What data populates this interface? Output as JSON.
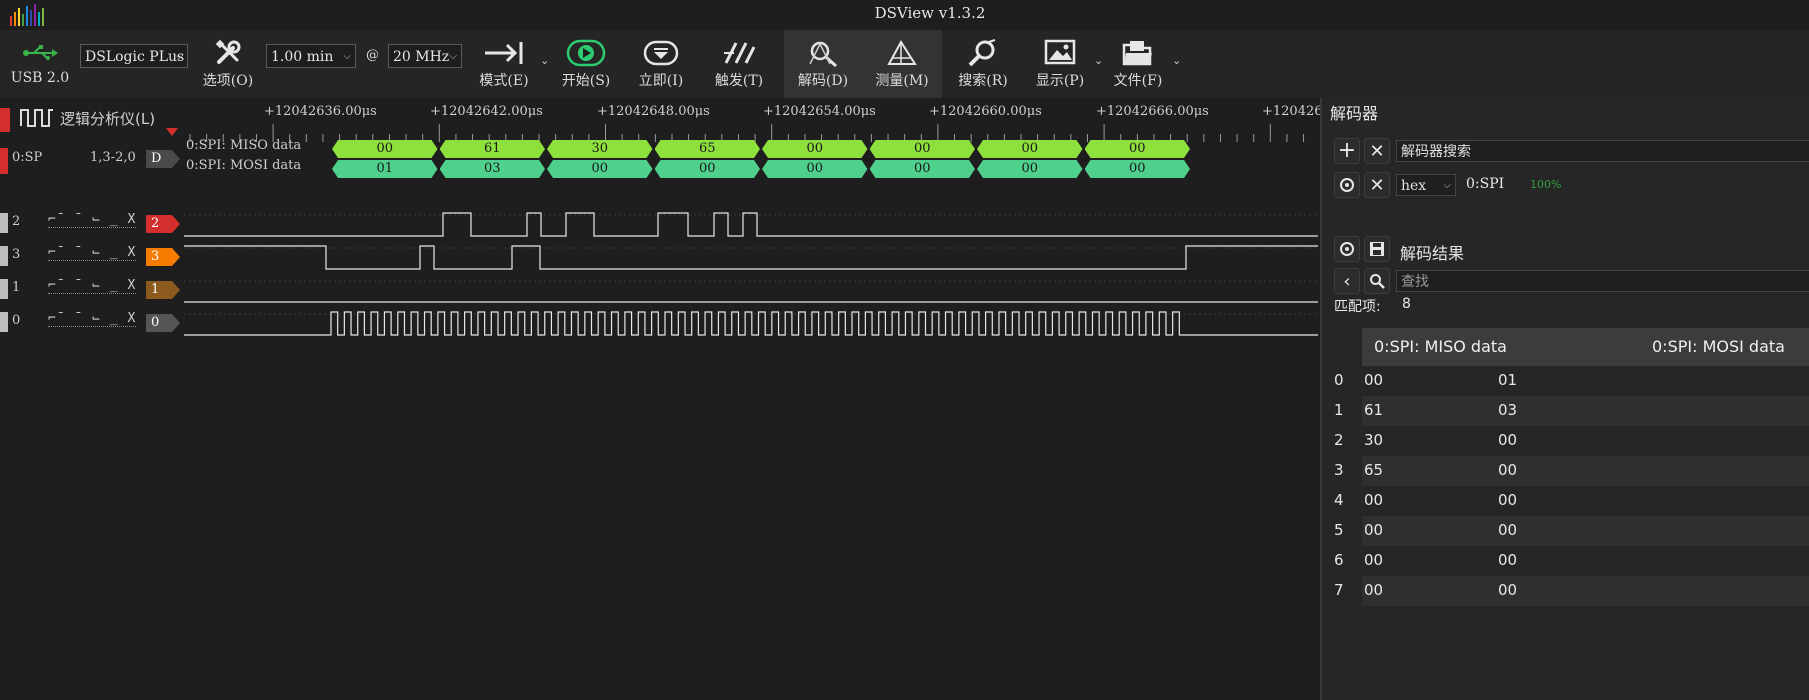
{
  "window": {
    "title": "DSView v1.3.2"
  },
  "toolbar": {
    "usb_label": "USB 2.0",
    "device_select": "DSLogic PLus",
    "options_label": "选项(O)",
    "duration_select": "1.00 min",
    "at_sign": "@",
    "rate_select": "20 MHz",
    "mode_label": "模式(E)",
    "start_label": "开始(S)",
    "instant_label": "立即(I)",
    "trigger_label": "触发(T)",
    "decode_label": "解码(D)",
    "measure_label": "测量(M)",
    "search_label": "搜索(R)",
    "display_label": "显示(P)",
    "file_label": "文件(F)"
  },
  "wave": {
    "header_label": "逻辑分析仪(L)",
    "ruler_ticks": [
      "+12042636.00μs",
      "+12042642.00μs",
      "+12042648.00μs",
      "+12042654.00μs",
      "+12042660.00μs",
      "+12042666.00μs",
      "+120426"
    ],
    "decoder_row": {
      "name": "0:SP",
      "channels": "1,3-2,0",
      "tag": "D",
      "miso_label": "0:SPI: MISO data",
      "mosi_label": "0:SPI: MOSI data",
      "miso_values": [
        "00",
        "61",
        "30",
        "65",
        "00",
        "00",
        "00",
        "00"
      ],
      "mosi_values": [
        "01",
        "03",
        "00",
        "00",
        "00",
        "00",
        "00",
        "00"
      ],
      "miso_color": "#8ee03c",
      "mosi_color": "#4fd08c"
    },
    "channels": [
      {
        "index": "2",
        "tag": "2",
        "color": "#d32f2f"
      },
      {
        "index": "3",
        "tag": "3",
        "color": "#f57c00"
      },
      {
        "index": "1",
        "tag": "1",
        "color": "#8d5a1e"
      },
      {
        "index": "0",
        "tag": "0",
        "color": "#555555"
      }
    ]
  },
  "decoder_panel": {
    "title": "解码器",
    "search_placeholder": "解码器搜索",
    "format_select": "hex",
    "decoder_name": "0:SPI",
    "progress": "100%",
    "results_title": "解码结果",
    "find_placeholder": "查找",
    "match_label": "匹配项:",
    "match_count": "8",
    "columns": [
      "0:SPI: MISO data",
      "0:SPI: MOSI data"
    ],
    "rows": [
      {
        "idx": "0",
        "miso": "00",
        "mosi": "01"
      },
      {
        "idx": "1",
        "miso": "61",
        "mosi": "03"
      },
      {
        "idx": "2",
        "miso": "30",
        "mosi": "00"
      },
      {
        "idx": "3",
        "miso": "65",
        "mosi": "00"
      },
      {
        "idx": "4",
        "miso": "00",
        "mosi": "00"
      },
      {
        "idx": "5",
        "miso": "00",
        "mosi": "00"
      },
      {
        "idx": "6",
        "miso": "00",
        "mosi": "00"
      },
      {
        "idx": "7",
        "miso": "00",
        "mosi": "00"
      }
    ]
  }
}
